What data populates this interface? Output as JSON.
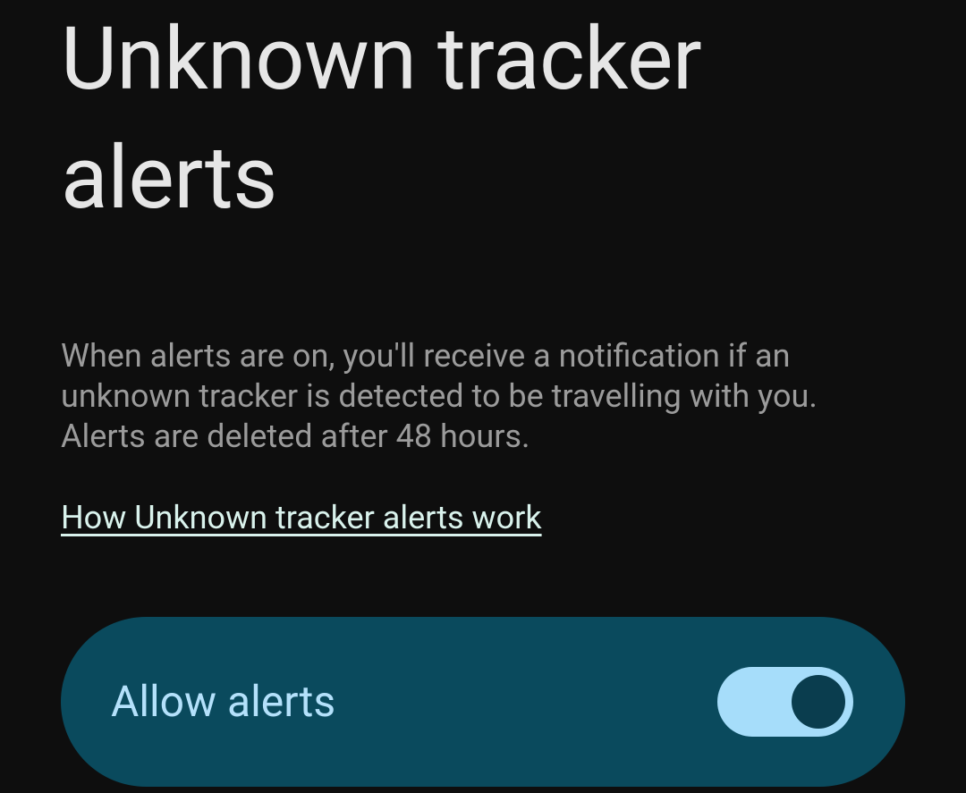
{
  "page": {
    "title": "Unknown tracker alerts",
    "description": "When alerts are on, you'll receive a notification if an unknown tracker is detected to be travelling with you. Alerts are deleted after 48 hours.",
    "link_text": "How Unknown tracker alerts work"
  },
  "toggle": {
    "label": "Allow alerts",
    "state": "on"
  },
  "colors": {
    "background": "#0e0e0e",
    "title_text": "#e6e6e6",
    "description_text": "#9b9b9b",
    "link_text": "#d9f2ec",
    "card_background": "#0a4a5d",
    "card_label": "#b4e1fb",
    "toggle_track_on": "#a6ddfa",
    "toggle_thumb_on": "#0a3d4e"
  }
}
